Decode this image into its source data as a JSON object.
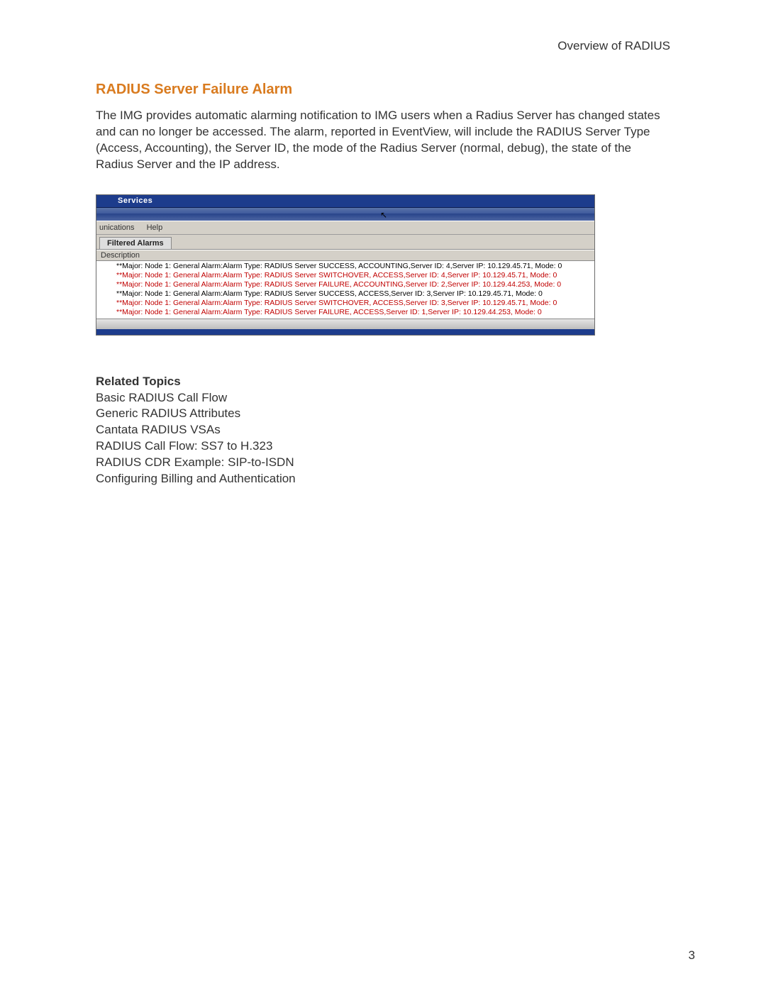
{
  "header": {
    "right": "Overview of RADIUS"
  },
  "section": {
    "title": "RADIUS Server Failure Alarm",
    "body": "The IMG provides automatic alarming notification to IMG users when a Radius Server has changed states and can no longer be accessed. The alarm, reported in EventView, will include the RADIUS Server Type (Access, Accounting), the Server ID, the mode of the Radius Server (normal, debug), the state of the Radius Server and the IP address."
  },
  "shot": {
    "title": "Services",
    "menubar": {
      "left": "unications",
      "help": "Help"
    },
    "tab": "Filtered Alarms",
    "colhead": "Description",
    "alarms": [
      {
        "color": "black",
        "text": "**Major: Node 1: General Alarm:Alarm Type: RADIUS Server SUCCESS, ACCOUNTING,Server ID: 4,Server IP: 10.129.45.71, Mode: 0"
      },
      {
        "color": "red",
        "text": "**Major: Node 1: General Alarm:Alarm Type: RADIUS Server SWITCHOVER, ACCESS,Server ID: 4,Server IP: 10.129.45.71, Mode: 0"
      },
      {
        "color": "red",
        "text": "**Major: Node 1: General Alarm:Alarm Type: RADIUS Server FAILURE, ACCOUNTING,Server ID: 2,Server IP: 10.129.44.253, Mode: 0"
      },
      {
        "color": "black",
        "text": "**Major: Node 1: General Alarm:Alarm Type: RADIUS Server SUCCESS, ACCESS,Server ID: 3,Server IP: 10.129.45.71, Mode: 0"
      },
      {
        "color": "red",
        "text": "**Major: Node 1: General Alarm:Alarm Type: RADIUS Server SWITCHOVER, ACCESS,Server ID: 3,Server IP: 10.129.45.71, Mode: 0"
      },
      {
        "color": "red",
        "text": "**Major: Node 1: General Alarm:Alarm Type: RADIUS Server FAILURE, ACCESS,Server ID: 1,Server IP: 10.129.44.253, Mode: 0"
      }
    ]
  },
  "related": {
    "title": "Related Topics",
    "items": [
      "Basic RADIUS Call Flow",
      "Generic RADIUS Attributes",
      "Cantata RADIUS VSAs",
      "RADIUS Call Flow: SS7 to H.323",
      "RADIUS CDR Example: SIP-to-ISDN",
      "Configuring Billing and Authentication"
    ]
  },
  "page_number": "3"
}
